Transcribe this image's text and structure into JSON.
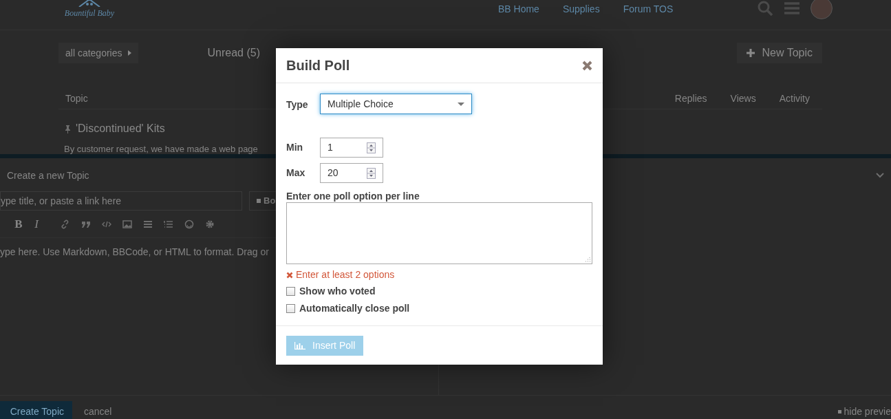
{
  "header": {
    "logo_text": "Bountiful Baby",
    "nav": [
      "BB Home",
      "Supplies",
      "Forum TOS"
    ]
  },
  "toolbar": {
    "category": "all categories",
    "filter": "Unread (5)",
    "new_topic": "New Topic"
  },
  "topic_list": {
    "columns": [
      "Topic",
      "Replies",
      "Views",
      "Activity"
    ],
    "rows": [
      {
        "title": "'Discontinued' Kits",
        "excerpt": "By customer request, we have made a web page",
        "pinned": true
      }
    ]
  },
  "composer": {
    "title": "Create a new Topic",
    "title_placeholder": "ype title, or paste a link here",
    "category_button": "Bo",
    "editor_tools": [
      {
        "kind": "bold",
        "label": "B"
      },
      {
        "kind": "italic",
        "label": "I"
      },
      {
        "kind": "link"
      },
      {
        "kind": "quote"
      },
      {
        "kind": "code"
      },
      {
        "kind": "image"
      },
      {
        "kind": "bullets"
      },
      {
        "kind": "numbers"
      },
      {
        "kind": "emoji"
      },
      {
        "kind": "gear"
      }
    ],
    "body_placeholder": "ype here. Use Markdown, BBCode, or HTML to format. Drag or",
    "submit": "Create Topic",
    "cancel": "cancel",
    "preview_toggle": "hide previe"
  },
  "dialog": {
    "title": "Build Poll",
    "type_label": "Type",
    "type_value": "Multiple Choice",
    "min_label": "Min",
    "min_value": "1",
    "max_label": "Max",
    "max_value": "20",
    "options_label": "Enter one poll option per line",
    "error": "Enter at least 2 options",
    "checkboxes": [
      {
        "label": "Show who voted",
        "checked": false
      },
      {
        "label": "Automatically close poll",
        "checked": false
      }
    ],
    "insert_button": {
      "label": "Insert Poll",
      "disabled": true
    }
  }
}
